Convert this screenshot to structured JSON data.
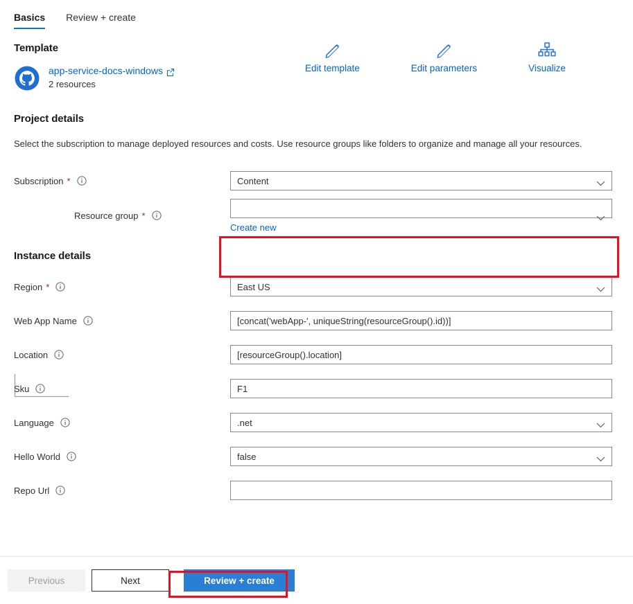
{
  "tabs": [
    {
      "label": "Basics",
      "active": true
    },
    {
      "label": "Review + create",
      "active": false
    }
  ],
  "template": {
    "heading": "Template",
    "repo_name": "app-service-docs-windows",
    "repo_icon": "github-icon",
    "external_link_icon": "external-link-icon",
    "resources": "2 resources",
    "actions": [
      {
        "label": "Edit template",
        "icon": "pencil-icon"
      },
      {
        "label": "Edit parameters",
        "icon": "pencil-icon"
      },
      {
        "label": "Visualize",
        "icon": "hierarchy-icon"
      }
    ]
  },
  "project_details": {
    "heading": "Project details",
    "description": "Select the subscription to manage deployed resources and costs. Use resource groups like folders to organize and manage all your resources.",
    "subscription": {
      "label": "Subscription",
      "required": "*",
      "info_icon": "info-icon",
      "value": "Content",
      "chevron_icon": "chevron-down-icon"
    },
    "resource_group": {
      "label": "Resource group",
      "required": "*",
      "info_icon": "info-icon",
      "value": "",
      "chevron_icon": "chevron-down-icon",
      "create_new_label": "Create new"
    }
  },
  "instance_details": {
    "heading": "Instance details",
    "fields": [
      {
        "label": "Region",
        "required": "*",
        "info_icon": "info-icon",
        "value": "East US",
        "type": "select",
        "chevron_icon": "chevron-down-icon"
      },
      {
        "label": "Web App Name",
        "required": "",
        "info_icon": "info-icon",
        "value": "[concat('webApp-', uniqueString(resourceGroup().id))]",
        "type": "text",
        "chevron_icon": ""
      },
      {
        "label": "Location",
        "required": "",
        "info_icon": "info-icon",
        "value": "[resourceGroup().location]",
        "type": "text",
        "chevron_icon": ""
      },
      {
        "label": "Sku",
        "required": "",
        "info_icon": "info-icon",
        "value": "F1",
        "type": "text",
        "chevron_icon": ""
      },
      {
        "label": "Language",
        "required": "",
        "info_icon": "info-icon",
        "value": ".net",
        "type": "select",
        "chevron_icon": "chevron-down-icon"
      },
      {
        "label": "Hello World",
        "required": "",
        "info_icon": "info-icon",
        "value": "false",
        "type": "select",
        "chevron_icon": "chevron-down-icon"
      },
      {
        "label": "Repo Url",
        "required": "",
        "info_icon": "info-icon",
        "value": "",
        "type": "text",
        "chevron_icon": ""
      }
    ]
  },
  "footer": {
    "previous_label": "Previous",
    "next_label": "Next",
    "review_create_label": "Review + create"
  },
  "colors": {
    "accent": "#0078d4",
    "link": "#0066cc",
    "primary_button": "#2a7fd4",
    "required_asterisk": "#a4262c",
    "annotation": "#e81123",
    "github_blue": "#1f6fd0"
  }
}
